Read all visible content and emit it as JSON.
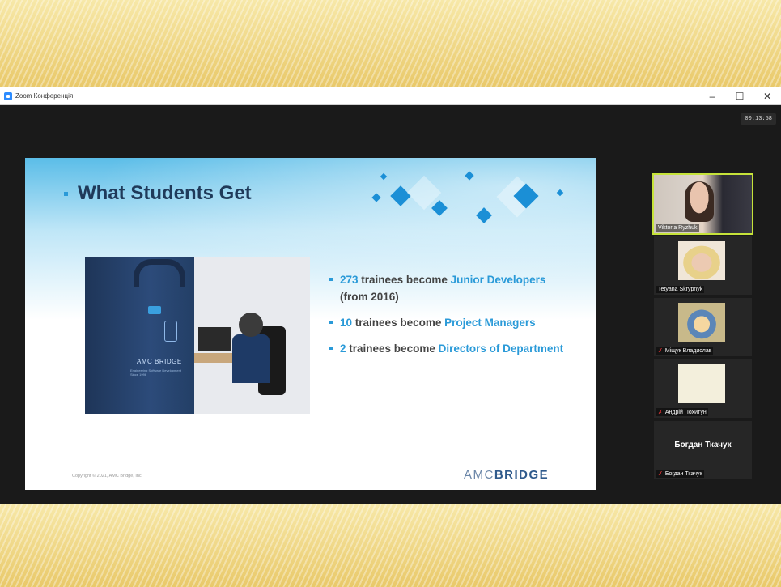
{
  "window": {
    "title": "Zoom Конференція",
    "controls": {
      "minimize": "–",
      "maximize": "☐",
      "close": "✕"
    },
    "timer": "00:13:58"
  },
  "slide": {
    "title": "What Students Get",
    "bullets": [
      {
        "num": "273",
        "text": "trainees become",
        "highlight": "Junior Developers",
        "suffix": "(from 2016)"
      },
      {
        "num": "10",
        "text": "trainees become",
        "highlight": "Project Managers",
        "suffix": ""
      },
      {
        "num": "2",
        "text": "trainees become",
        "highlight": "Directors of Department",
        "suffix": ""
      }
    ],
    "photo": {
      "bag_logo": "AMC BRIDGE",
      "bag_tagline": "Engineering Software Development Since 1996"
    },
    "copyright": "Copyright © 2021, AMC Bridge, Inc.",
    "logo_light": "AMC",
    "logo_bold": "BRIDGE",
    "accent_color": "#2a9ad8"
  },
  "participants": [
    {
      "name": "Viktoria Ryzhuk",
      "muted": false,
      "active": true,
      "video": true
    },
    {
      "name": "Tetyana Skrypnyk",
      "muted": false,
      "active": false,
      "video": true
    },
    {
      "name": "Міщук Владислав",
      "muted": true,
      "active": false,
      "video": true
    },
    {
      "name": "Андрій Похитун",
      "muted": true,
      "active": false,
      "video": true
    },
    {
      "name": "Богдан Ткачук",
      "display_name": "Богдан Ткачук",
      "muted": true,
      "active": false,
      "video": false
    }
  ],
  "icons": {
    "app": "zoom-icon",
    "muted": "mic-muted-icon"
  }
}
